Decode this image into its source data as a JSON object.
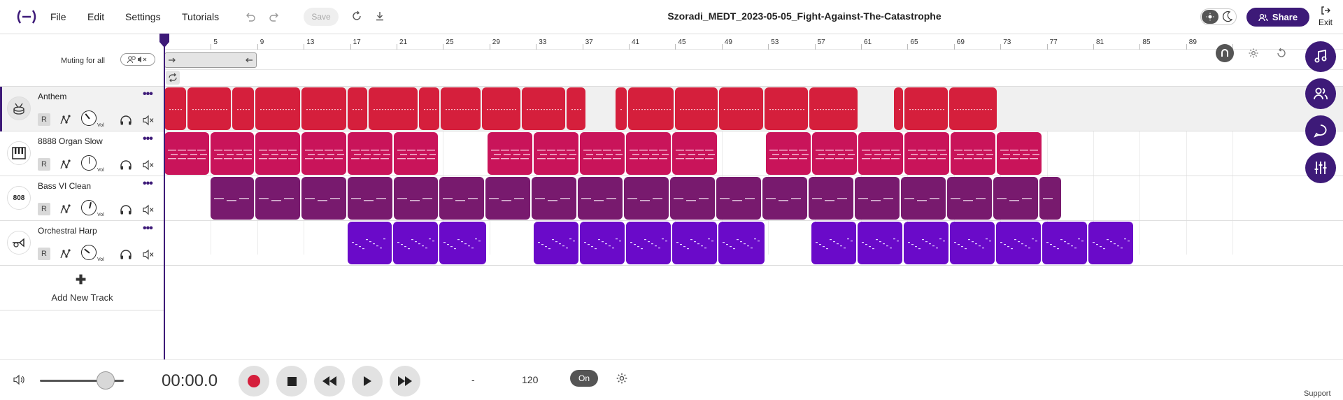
{
  "menu": {
    "file": "File",
    "edit": "Edit",
    "settings": "Settings",
    "tutorials": "Tutorials"
  },
  "toolbar": {
    "save_label": "Save",
    "project_title": "Szoradi_MEDT_2023-05-05_Fight-Against-The-Catastrophe",
    "share_label": "Share",
    "exit_label": "Exit"
  },
  "header": {
    "muting_label": "Muting for all"
  },
  "ruler": {
    "bars": [
      "5",
      "9",
      "13",
      "17",
      "21",
      "25",
      "29",
      "33",
      "37",
      "41",
      "45",
      "49",
      "53",
      "57",
      "61",
      "65",
      "69",
      "73",
      "77",
      "81",
      "85",
      "89"
    ]
  },
  "tracks": [
    {
      "name": "Anthem",
      "instrument_icon": "drum-icon",
      "vol_label": "Vol",
      "record_label": "R",
      "color": "#d51f3c",
      "volume": 0.35
    },
    {
      "name": "8888 Organ Slow",
      "instrument_icon": "piano-icon",
      "icon_text": "",
      "vol_label": "Vol",
      "record_label": "R",
      "color": "#c9145a",
      "volume": 0.5
    },
    {
      "name": "Bass VI Clean",
      "instrument_icon": "808-icon",
      "icon_text": "808",
      "vol_label": "Vol",
      "record_label": "R",
      "color": "#781a6e",
      "volume": 0.55
    },
    {
      "name": "Orchestral Harp",
      "instrument_icon": "trumpet-icon",
      "vol_label": "Vol",
      "record_label": "R",
      "color": "#6a0ac9",
      "volume": 0.3
    }
  ],
  "add_track_label": "Add New Track",
  "transport": {
    "time": "00:00.0",
    "dash": "-",
    "bpm": "120",
    "metronome_label": "On",
    "master_volume": 0.78
  },
  "support_label": "Support",
  "colors": {
    "accent": "#3d1a78",
    "anthem": "#d51f3c",
    "organ": "#c9145a",
    "bass": "#781a6e",
    "harp": "#6a0ac9"
  }
}
